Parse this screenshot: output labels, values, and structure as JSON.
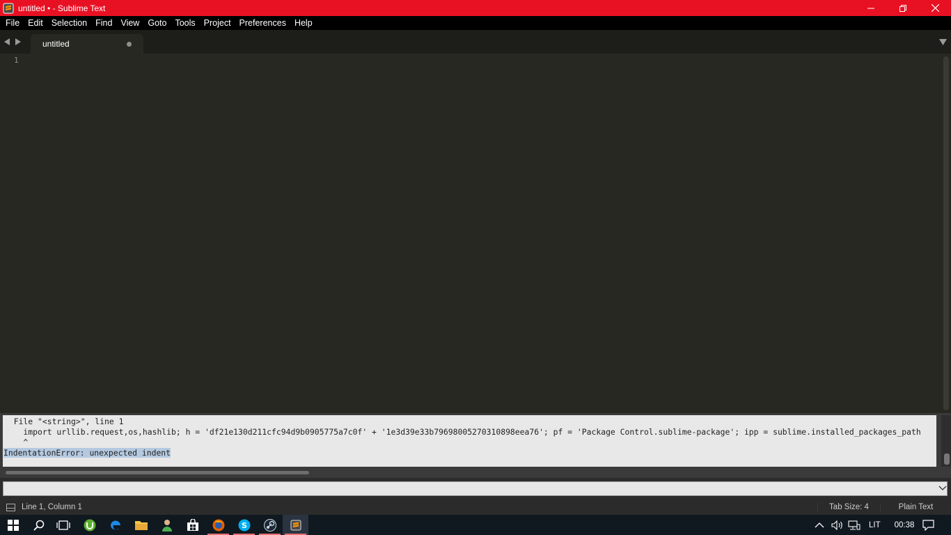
{
  "window": {
    "title": "untitled • - Sublime Text",
    "accent_color": "#e81123"
  },
  "menu": [
    "File",
    "Edit",
    "Selection",
    "Find",
    "View",
    "Goto",
    "Tools",
    "Project",
    "Preferences",
    "Help"
  ],
  "tabs": [
    {
      "label": "untitled",
      "dirty": true
    }
  ],
  "editor": {
    "line_numbers": [
      "1"
    ]
  },
  "console": {
    "lines": [
      "  File \"<string>\", line 1",
      "    import urllib.request,os,hashlib; h = 'df21e130d211cfc94d9b0905775a7c0f' + '1e3d39e33b79698005270310898eea76'; pf = 'Package Control.sublime-package'; ipp = sublime.installed_packages_path",
      "    ^",
      "IndentationError: unexpected indent"
    ]
  },
  "input": {
    "value": ""
  },
  "statusbar": {
    "position": "Line 1, Column 1",
    "tab_size": "Tab Size: 4",
    "syntax": "Plain Text"
  },
  "taskbar": {
    "items": [
      "start-icon",
      "search-icon",
      "task-view-icon",
      "utorrent-icon",
      "edge-icon",
      "file-explorer-icon",
      "people-icon",
      "store-icon",
      "firefox-icon",
      "skype-icon",
      "steam-icon",
      "sublime-text-icon"
    ],
    "language": "LIT",
    "time": "00:38"
  }
}
